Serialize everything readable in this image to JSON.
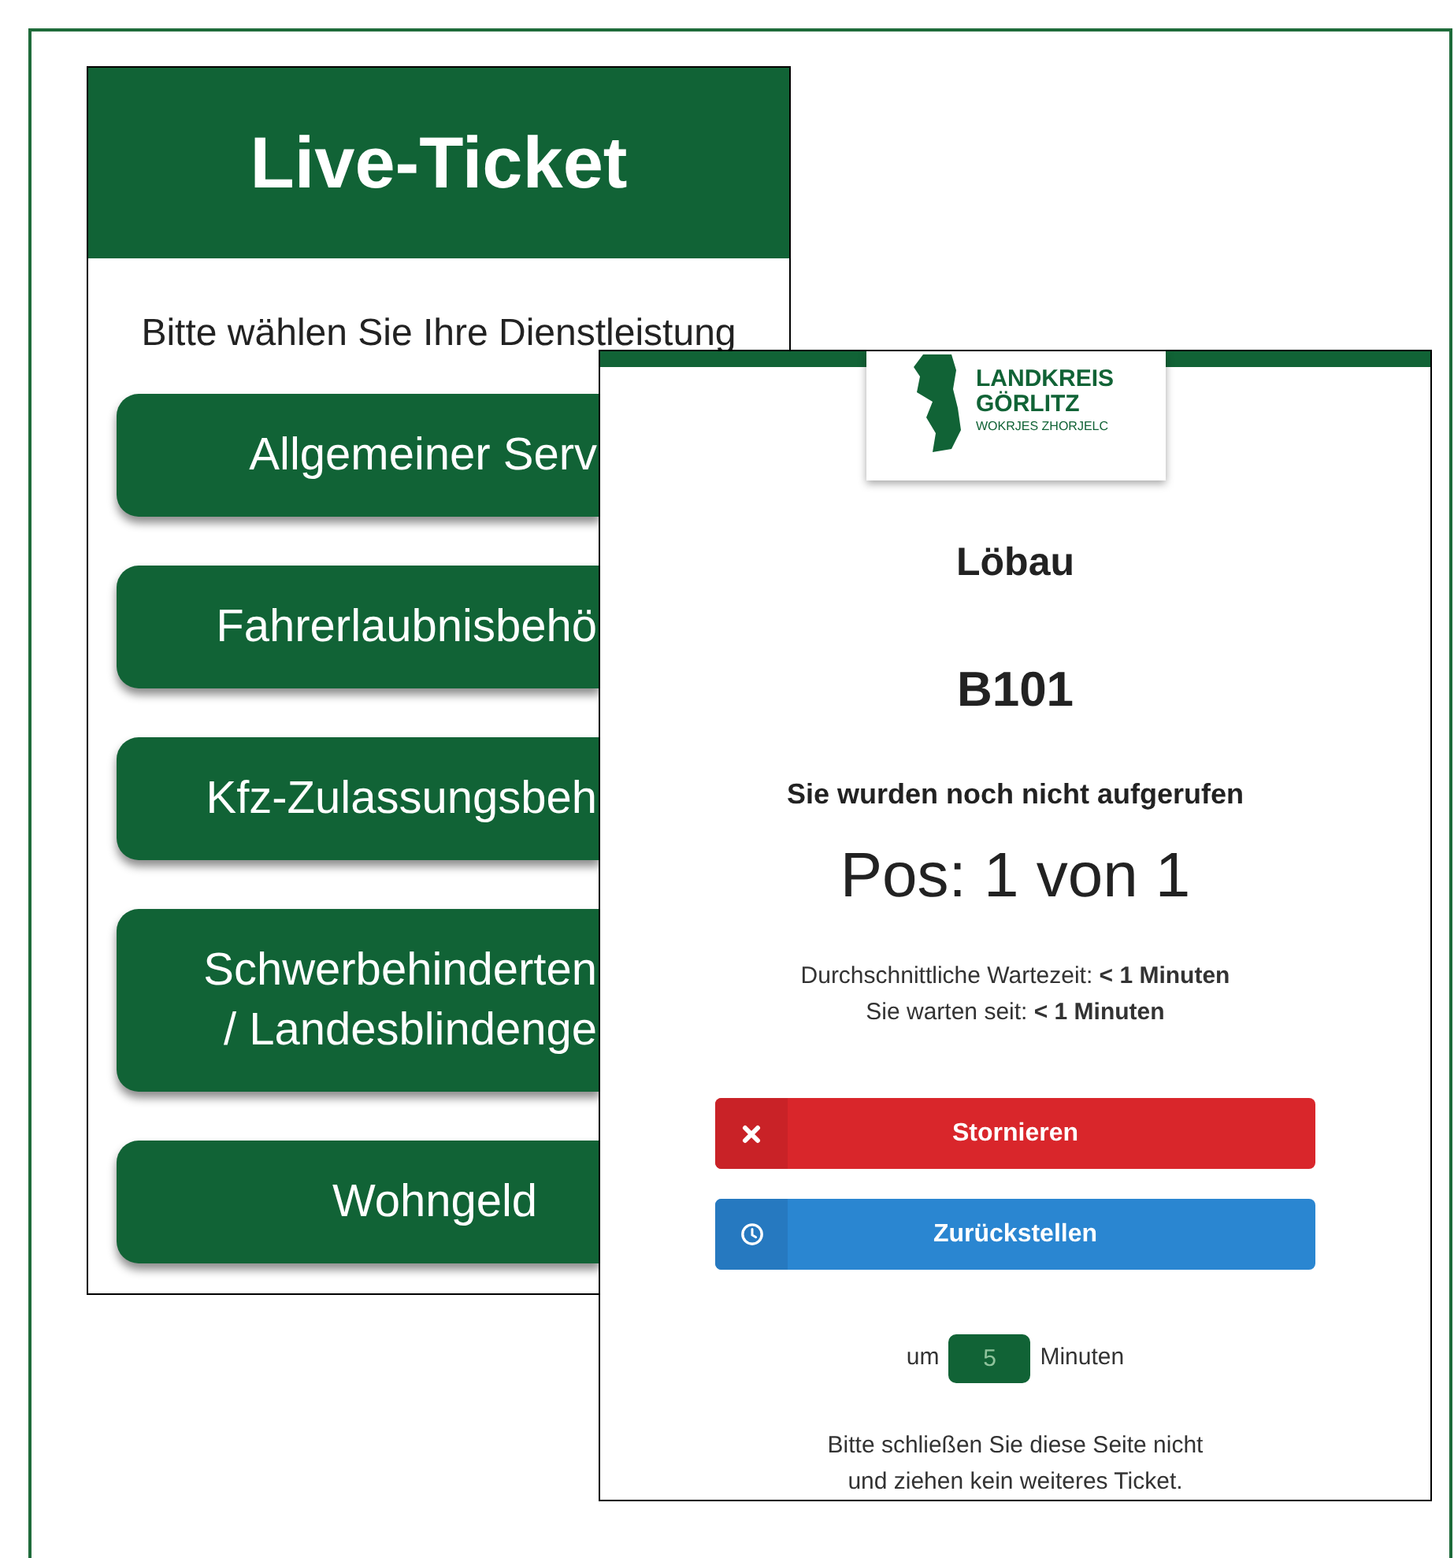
{
  "service_screen": {
    "title": "Live-Ticket",
    "prompt": "Bitte wählen Sie Ihre Dienstleistung",
    "buttons": [
      {
        "lines": [
          "Allgemeiner Serv"
        ],
        "clipped": true
      },
      {
        "lines": [
          "Fahrerlaubnisbehö"
        ],
        "clipped": true
      },
      {
        "lines": [
          "Kfz-Zulassungsbeh"
        ],
        "clipped": true
      },
      {
        "lines": [
          "Schwerbehinderten",
          "/ Landesblindenge"
        ],
        "clipped": true
      },
      {
        "lines": [
          "Wohngeld"
        ],
        "clipped": false
      }
    ]
  },
  "ticket_screen": {
    "logo": {
      "name_lines": [
        "LANDKREIS",
        "GÖRLITZ"
      ],
      "subtitle": "WOKRJES ZHORJELC"
    },
    "location": "Löbau",
    "ticket_number": "B101",
    "status": "Sie wurden noch nicht aufgerufen",
    "position": "Pos: 1 von 1",
    "wait_lines": [
      "Durchschnittliche Wartezeit: **< 1 Minuten**",
      "Sie warten seit: **< 1 Minuten**"
    ],
    "actions": [
      {
        "kind": "cancel",
        "label": "Stornieren"
      },
      {
        "kind": "postpone",
        "label": "Zurückstellen"
      }
    ],
    "postpone": {
      "prefix": "um",
      "value": "5",
      "suffix": "Minuten"
    },
    "footer": [
      "Bitte schließen Sie diese Seite nicht",
      "und ziehen kein weiteres Ticket."
    ]
  }
}
